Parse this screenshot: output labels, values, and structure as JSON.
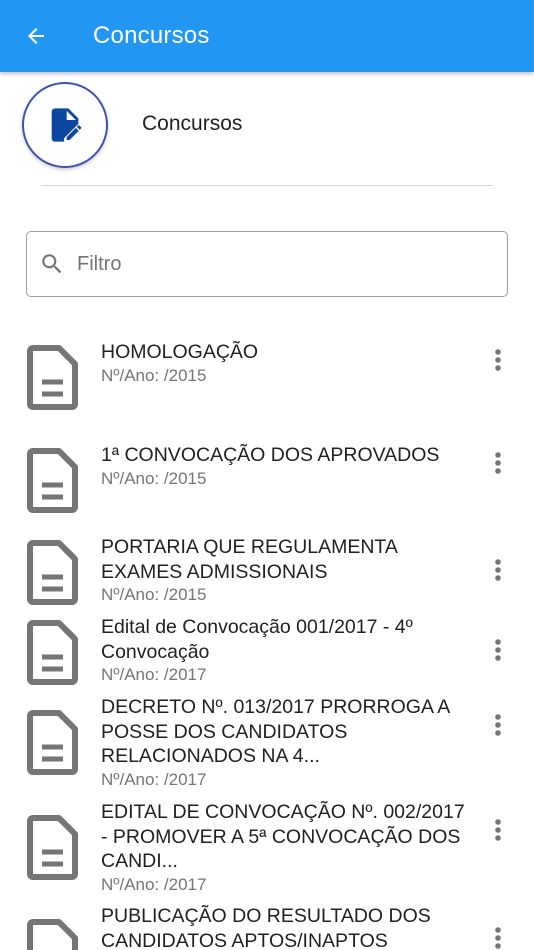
{
  "appbar": {
    "title": "Concursos",
    "back_icon": "arrow-left-icon",
    "background": "#2196F3"
  },
  "header": {
    "title": "Concursos",
    "icon": "document-edit-icon",
    "icon_color": "#0D47A1"
  },
  "search": {
    "placeholder": "Filtro",
    "value": "",
    "icon": "search-icon"
  },
  "items": [
    {
      "title": "HOMOLOGAÇÃO",
      "subtitle": "Nº/Ano: /2015"
    },
    {
      "title": "1ª CONVOCAÇÃO DOS APROVADOS",
      "subtitle": "Nº/Ano: /2015"
    },
    {
      "title": "PORTARIA QUE REGULAMENTA EXAMES ADMISSIONAIS",
      "subtitle": "Nº/Ano: /2015"
    },
    {
      "title": "Edital de Convocação 001/2017 - 4º Convocação",
      "subtitle": "Nº/Ano: /2017"
    },
    {
      "title": "DECRETO Nº. 013/2017 PRORROGA A POSSE DOS CANDIDATOS RELACIONADOS NA 4...",
      "subtitle": "Nº/Ano: /2017"
    },
    {
      "title": "EDITAL DE CONVOCAÇÃO Nº. 002/2017 - PROMOVER A 5ª CONVOCAÇÃO DOS CANDI...",
      "subtitle": "Nº/Ano: /2017"
    },
    {
      "title": "PUBLICAÇÃO DO RESULTADO DOS CANDIDATOS APTOS/INAPTOS",
      "subtitle": ""
    }
  ]
}
